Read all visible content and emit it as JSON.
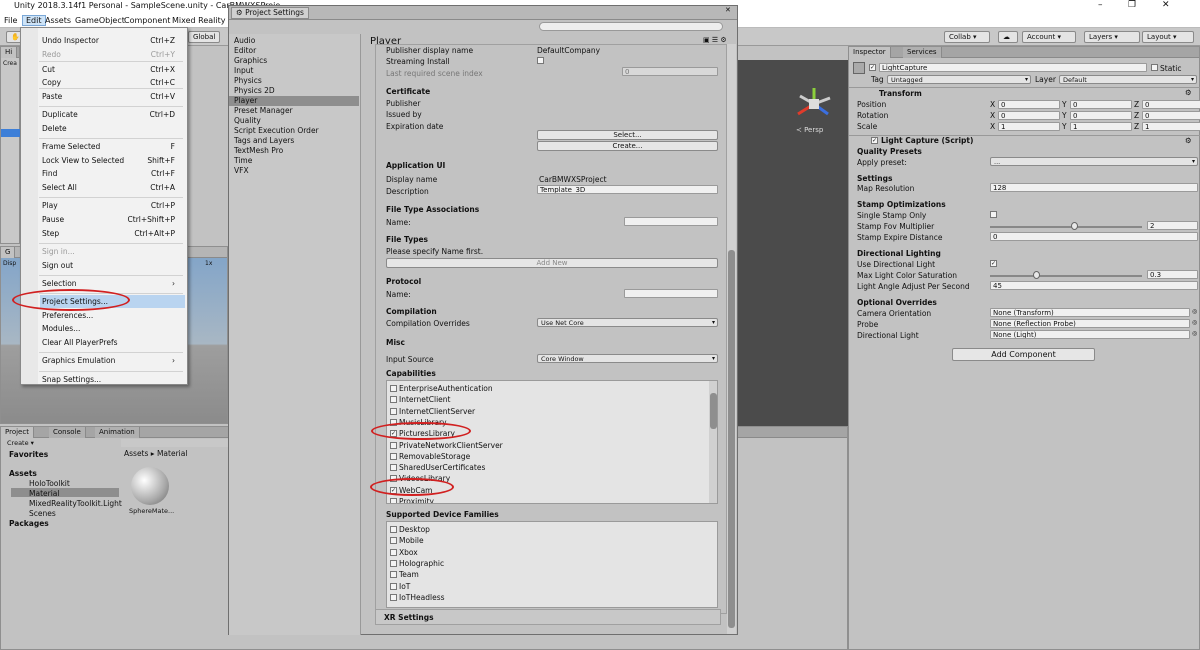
{
  "window": {
    "title": "Unity 2018.3.14f1 Personal - SampleScene.unity - CarBMWXSProje",
    "controls": [
      "–",
      "❐",
      "✕"
    ]
  },
  "menubar": [
    "File",
    "Edit",
    "Assets",
    "GameObject",
    "Component",
    "Mixed Reality Too"
  ],
  "toolbar": {
    "global": "Global",
    "collab": "Collab ▾",
    "account": "Account ▾",
    "layers": "Layers ▾",
    "layout": "Layout ▾",
    "cloud_icon": "cloud-icon"
  },
  "edit_menu": [
    {
      "label": "Undo Inspector",
      "shortcut": "Ctrl+Z"
    },
    {
      "label": "Redo",
      "shortcut": "Ctrl+Y",
      "disabled": true
    },
    {
      "label": "Cut",
      "shortcut": "Ctrl+X"
    },
    {
      "label": "Copy",
      "shortcut": "Ctrl+C"
    },
    {
      "label": "Paste",
      "shortcut": "Ctrl+V"
    },
    {
      "label": "Duplicate",
      "shortcut": "Ctrl+D"
    },
    {
      "label": "Delete",
      "shortcut": ""
    },
    {
      "label": "Frame Selected",
      "shortcut": "F"
    },
    {
      "label": "Lock View to Selected",
      "shortcut": "Shift+F"
    },
    {
      "label": "Find",
      "shortcut": "Ctrl+F"
    },
    {
      "label": "Select All",
      "shortcut": "Ctrl+A"
    },
    {
      "label": "Play",
      "shortcut": "Ctrl+P"
    },
    {
      "label": "Pause",
      "shortcut": "Ctrl+Shift+P"
    },
    {
      "label": "Step",
      "shortcut": "Ctrl+Alt+P"
    },
    {
      "label": "Sign in...",
      "shortcut": "",
      "disabled": true
    },
    {
      "label": "Sign out",
      "shortcut": ""
    },
    {
      "label": "Selection",
      "shortcut": "›"
    },
    {
      "label": "Project Settings...",
      "shortcut": ""
    },
    {
      "label": "Preferences...",
      "shortcut": ""
    },
    {
      "label": "Modules...",
      "shortcut": ""
    },
    {
      "label": "Clear All PlayerPrefs",
      "shortcut": ""
    },
    {
      "label": "Graphics Emulation",
      "shortcut": "›"
    },
    {
      "label": "Snap Settings...",
      "shortcut": ""
    }
  ],
  "hierarchy": {
    "tab": "Hi",
    "create": "Crea"
  },
  "game": {
    "tab": "G",
    "display": "Disp",
    "scale": "1x"
  },
  "project_settings": {
    "title": "Project Settings",
    "categories": [
      "Audio",
      "Editor",
      "Graphics",
      "Input",
      "Physics",
      "Physics 2D",
      "Player",
      "Preset Manager",
      "Quality",
      "Script Execution Order",
      "Tags and Layers",
      "TextMesh Pro",
      "Time",
      "VFX"
    ],
    "selected": "Player",
    "heading": "Player",
    "top": {
      "publisher_label": "Publisher display name",
      "publisher_value": "DefaultCompany",
      "streaming": "Streaming Install",
      "scene_index": "Last required scene index",
      "scene_value": "0"
    },
    "certificate": {
      "title": "Certificate",
      "publisher": "Publisher",
      "issued": "Issued by",
      "expiration": "Expiration date",
      "select": "Select...",
      "create": "Create..."
    },
    "app_ui": {
      "title": "Application UI",
      "display_label": "Display name",
      "display_value": "CarBMWXSProject",
      "desc_label": "Description",
      "desc_value": "Template_3D"
    },
    "fta": {
      "title": "File Type Associations",
      "name": "Name:"
    },
    "file_types": {
      "title": "File Types",
      "note": "Please specify Name first.",
      "add": "Add New"
    },
    "protocol": {
      "title": "Protocol",
      "name": "Name:"
    },
    "compilation": {
      "title": "Compilation",
      "label": "Compilation Overrides",
      "value": "Use Net Core"
    },
    "misc": {
      "title": "Misc",
      "label": "Input Source",
      "value": "Core Window"
    },
    "capabilities": {
      "title": "Capabilities",
      "items": [
        {
          "name": "EnterpriseAuthentication",
          "checked": false
        },
        {
          "name": "InternetClient",
          "checked": false
        },
        {
          "name": "InternetClientServer",
          "checked": false
        },
        {
          "name": "MusicLibrary",
          "checked": false
        },
        {
          "name": "PicturesLibrary",
          "checked": true
        },
        {
          "name": "PrivateNetworkClientServer",
          "checked": false
        },
        {
          "name": "RemovableStorage",
          "checked": false
        },
        {
          "name": "SharedUserCertificates",
          "checked": false
        },
        {
          "name": "VideosLibrary",
          "checked": false
        },
        {
          "name": "WebCam",
          "checked": true
        },
        {
          "name": "Proximity",
          "checked": false
        }
      ]
    },
    "families": {
      "title": "Supported Device Families",
      "items": [
        "Desktop",
        "Mobile",
        "Xbox",
        "Holographic",
        "Team",
        "IoT",
        "IoTHeadless"
      ]
    },
    "xr": "XR Settings"
  },
  "scene": {
    "persp": "≺ Persp"
  },
  "inspector": {
    "tabs": [
      "Inspector",
      "Services"
    ],
    "object_name": "LightCapture",
    "static": "Static",
    "tag_label": "Tag",
    "tag": "Untagged",
    "layer_label": "Layer",
    "layer": "Default",
    "transform": {
      "title": "Transform",
      "rows": [
        {
          "label": "Position",
          "x": "0",
          "y": "0",
          "z": "0"
        },
        {
          "label": "Rotation",
          "x": "0",
          "y": "0",
          "z": "0"
        },
        {
          "label": "Scale",
          "x": "1",
          "y": "1",
          "z": "1"
        }
      ]
    },
    "script": {
      "title": "Light Capture (Script)",
      "quality_presets": "Quality Presets",
      "apply_label": "Apply preset:",
      "apply_value": "...",
      "settings": "Settings",
      "map_label": "Map Resolution",
      "map_value": "128",
      "stamp": "Stamp Optimizations",
      "single_label": "Single Stamp Only",
      "fov_label": "Stamp Fov Multiplier",
      "fov_value": "2",
      "fov_level": 0.55,
      "expire_label": "Stamp Expire Distance",
      "expire_value": "0",
      "dl": "Directional Lighting",
      "use_label": "Use Directional Light",
      "sat_label": "Max Light Color Saturation",
      "sat_value": "0.3",
      "sat_level": 0.3,
      "angle_label": "Light Angle Adjust Per Second",
      "angle_value": "45",
      "optional": "Optional Overrides",
      "cam_label": "Camera Orientation",
      "cam_value": "None (Transform)",
      "probe_label": "Probe",
      "probe_value": "None (Reflection Probe)",
      "dlight_label": "Directional Light",
      "dlight_value": "None (Light)"
    },
    "add_component": "Add Component"
  },
  "project": {
    "tabs": [
      "Project",
      "Console",
      "Animation"
    ],
    "create": "Create ▾",
    "tree": [
      "Favorites",
      "Assets",
      "HoloToolkit",
      "Material",
      "MixedRealityToolkit.Light",
      "Scenes",
      "Packages"
    ],
    "breadcrumb": "Assets ▸ Material",
    "asset": "SphereMate..."
  }
}
